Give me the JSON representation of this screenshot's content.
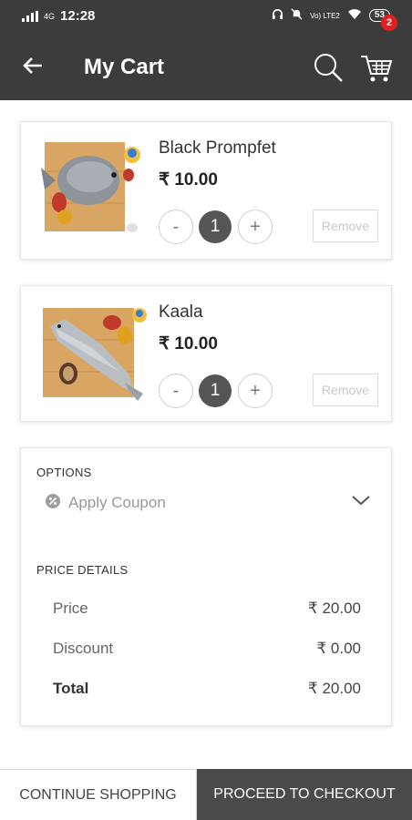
{
  "status_bar": {
    "time": "12:28",
    "network": "4G",
    "lte": "Vo) LTE2",
    "battery": "53"
  },
  "header": {
    "title": "My Cart",
    "cart_count": "2",
    "icons": [
      "back-arrow-icon",
      "search-icon",
      "cart-icon"
    ]
  },
  "cart": {
    "items": [
      {
        "name": "Black Prompfet",
        "price": "₹ 10.00",
        "quantity": "1",
        "minus": "-",
        "plus": "+",
        "remove_label": "Remove",
        "image": "pomfret-fish-on-board"
      },
      {
        "name": "Kaala",
        "price": "₹ 10.00",
        "quantity": "1",
        "minus": "-",
        "plus": "+",
        "remove_label": "Remove",
        "image": "kaala-fish-on-board"
      }
    ]
  },
  "options": {
    "label": "OPTIONS",
    "coupon_label": "Apply Coupon"
  },
  "price_details": {
    "label": "PRICE DETAILS",
    "rows": [
      {
        "label": "Price",
        "amount": "₹ 20.00"
      },
      {
        "label": "Discount",
        "amount": "₹ 0.00"
      },
      {
        "label": "Total",
        "amount": "₹ 20.00"
      }
    ]
  },
  "footer": {
    "continue_label": "CONTINUE SHOPPING",
    "checkout_label": "PROCEED TO CHECKOUT"
  },
  "colors": {
    "header_bg": "#3c3c3c",
    "badge": "#e02020",
    "checkout_bg": "#4a4a4a"
  }
}
